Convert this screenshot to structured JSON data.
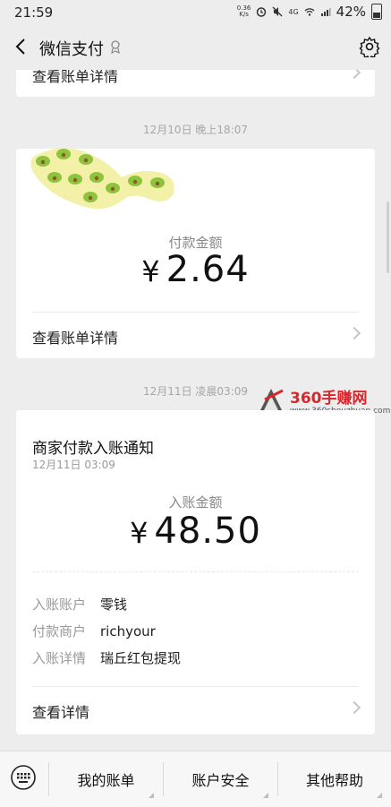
{
  "status_bar": {
    "time": "21:59",
    "speed_value": "0.36",
    "speed_unit": "K/s",
    "battery": "42%",
    "network": "4G",
    "icons": [
      "alarm-icon",
      "mute-icon",
      "wifi-icon",
      "signal-icon",
      "battery-icon"
    ]
  },
  "nav": {
    "title": "微信支付",
    "back_icon": "back-arrow-icon",
    "settings_icon": "gear-icon"
  },
  "card_top_partial": {
    "detail_label": "查看账单详情"
  },
  "message1": {
    "timestamp": "12月10日 晚上18:07",
    "amount_label": "付款金额",
    "currency": "¥",
    "amount": "2.64",
    "detail_label": "查看账单详情"
  },
  "message2": {
    "timestamp": "12月11日 凌晨03:09",
    "title": "商家付款入账通知",
    "subtitle": "12月11日 03:09",
    "amount_label": "入账金额",
    "currency": "¥",
    "amount": "48.50",
    "rows": [
      {
        "key": "入账账户",
        "value": "零钱"
      },
      {
        "key": "付款商户",
        "value": "richyour"
      },
      {
        "key": "入账详情",
        "value": "瑞丘红包提现"
      }
    ],
    "detail_label": "查看详情"
  },
  "watermark": {
    "logo": "360手赚网",
    "url": "www.360shouzhuan.com"
  },
  "bottom_bar": {
    "keyboard_icon": "keyboard-icon",
    "tabs": [
      "我的账单",
      "账户安全",
      "其他帮助"
    ]
  },
  "colors": {
    "background": "#ededed",
    "card": "#ffffff",
    "watermark_red": "#d9262b",
    "avocado_green": "#8fc33d"
  }
}
